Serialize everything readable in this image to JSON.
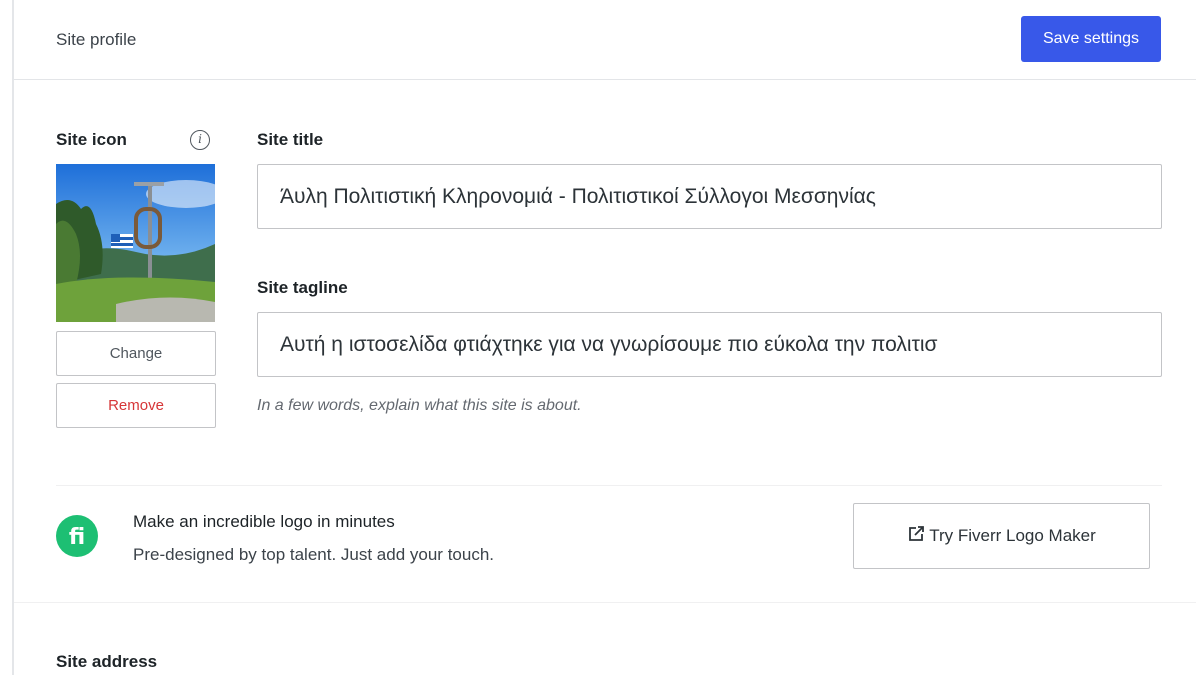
{
  "header": {
    "title": "Site profile",
    "save_label": "Save settings"
  },
  "site_icon": {
    "label": "Site icon",
    "info_glyph": "i",
    "change_label": "Change",
    "remove_label": "Remove"
  },
  "site_title": {
    "label": "Site title",
    "value": "Άυλη Πολιτιστική Κληρονομιά - Πολιτιστικοί Σύλλογοι Μεσσηνίας"
  },
  "site_tagline": {
    "label": "Site tagline",
    "value": "Αυτή η ιστοσελίδα φτιάχτηκε για να γνωρίσουμε πιο εύκολα την πολιτισ",
    "help": "In a few words, explain what this site is about."
  },
  "fiverr": {
    "title": "Make an incredible logo in minutes",
    "subtitle": "Pre-designed by top talent. Just add your touch.",
    "button_label": "Try Fiverr Logo Maker",
    "logo_text": "fi"
  },
  "site_address": {
    "label": "Site address"
  },
  "colors": {
    "accent": "#3858e9",
    "fiverr_green": "#1dbf73",
    "remove_red": "#d63638"
  }
}
